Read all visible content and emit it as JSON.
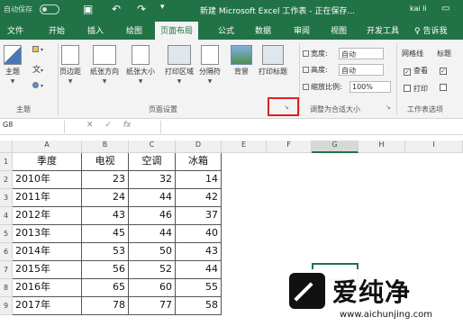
{
  "titlebar": {
    "autosave_label": "自动保存",
    "title": "新建 Microsoft Excel 工作表 - 正在保存...",
    "user": "kai li"
  },
  "tabs": [
    "文件",
    "开始",
    "插入",
    "绘图",
    "页面布局",
    "公式",
    "数据",
    "审阅",
    "视图",
    "开发工具"
  ],
  "active_tab": "页面布局",
  "tell_me": "告诉我",
  "ribbon": {
    "themes": {
      "main_label": "主题",
      "group_label": "主题"
    },
    "page_setup": {
      "buttons": [
        "页边距",
        "纸张方向",
        "纸张大小",
        "打印区域",
        "分隔符",
        "背景",
        "打印标题"
      ],
      "group_label": "页面设置"
    },
    "scale_to_fit": {
      "width_label": "宽度:",
      "width_value": "自动",
      "height_label": "高度:",
      "height_value": "自动",
      "scale_label": "缩放比例:",
      "scale_value": "100%",
      "group_label": "调整为合适大小"
    },
    "sheet_options": {
      "gridlines_label": "网格线",
      "headings_label": "标题",
      "view_label": "查看",
      "print_label": "打印",
      "group_label": "工作表选项"
    }
  },
  "formula_bar": {
    "name_box": "G8",
    "fx": "fx",
    "value": ""
  },
  "sheet": {
    "columns": [
      "A",
      "B",
      "C",
      "D",
      "E",
      "F",
      "G",
      "H",
      "I"
    ],
    "selected_column": "G",
    "rows": [
      "1",
      "2",
      "3",
      "4",
      "5",
      "6",
      "7",
      "8",
      "9"
    ],
    "headers": [
      "季度",
      "电视",
      "空调",
      "冰箱"
    ],
    "data": [
      [
        "2010年",
        "23",
        "32",
        "14"
      ],
      [
        "2011年",
        "24",
        "44",
        "42"
      ],
      [
        "2012年",
        "43",
        "46",
        "37"
      ],
      [
        "2013年",
        "45",
        "44",
        "40"
      ],
      [
        "2014年",
        "53",
        "50",
        "43"
      ],
      [
        "2015年",
        "56",
        "52",
        "44"
      ],
      [
        "2016年",
        "65",
        "60",
        "55"
      ],
      [
        "2017年",
        "78",
        "77",
        "58"
      ]
    ]
  },
  "watermark": {
    "brand": "爱纯净",
    "url": "www.aichunjing.com"
  },
  "colors": {
    "accent": "#217346",
    "highlight": "#e02020"
  }
}
